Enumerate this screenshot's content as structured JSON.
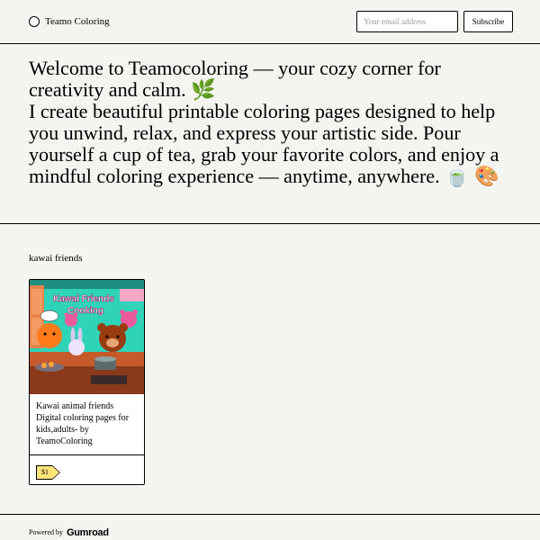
{
  "header": {
    "brand_name": "Teamo Coloring",
    "email_placeholder": "Your email address",
    "subscribe_label": "Subscribe"
  },
  "hero": {
    "lines": [
      "Welcome to Teamocoloring — your cozy corner for creativity and calm. 🌿",
      "I create beautiful printable coloring pages designed to help you unwind, relax, and express your artistic side. Pour yourself a cup of tea, grab your favorite colors, and enjoy a mindful coloring experience — anytime, anywhere. 🍵 🎨"
    ]
  },
  "section": {
    "title": "kawai friends"
  },
  "products": [
    {
      "thumbnail_title_1": "Kawai Friends",
      "thumbnail_title_2": "Cooking",
      "name": "Kawai animal friends Digital coloring pages for kids,adults- by TeamoColoring",
      "price": "$1"
    }
  ],
  "footer": {
    "powered_by": "Powered by",
    "brand": "Gumroad"
  },
  "colors": {
    "background": "#f4f4f0",
    "price_tag": "#ffe57a",
    "border": "#000000"
  }
}
